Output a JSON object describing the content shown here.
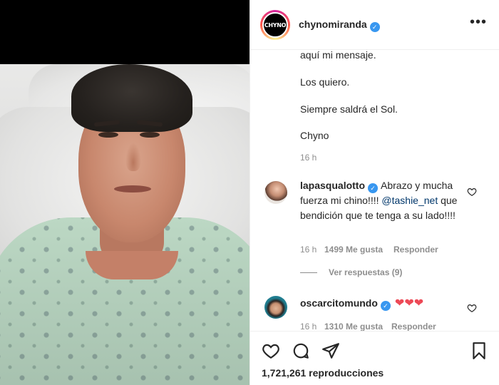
{
  "post": {
    "username": "chynomiranda",
    "avatar_text": "CHYNO",
    "more_icon": "more-horizontal-icon",
    "caption_lines": [
      "aquí mi mensaje.",
      "Los quiero.",
      "Siempre saldrá el Sol.",
      "Chyno"
    ],
    "caption_time": "16 h"
  },
  "comments": [
    {
      "user": "lapasqualotto",
      "text_before": "Abrazo y mucha fuerza mi chino!!!! ",
      "mention": "@tashie_net",
      "text_after": " que bendición que te tenga a su lado!!!!",
      "time": "16 h",
      "likes": "1499 Me gusta",
      "reply_label": "Responder",
      "view_replies": "Ver respuestas (9)"
    },
    {
      "user": "oscarcitomundo",
      "text": "❤❤❤",
      "time": "16 h",
      "likes": "1310 Me gusta",
      "reply_label": "Responder"
    }
  ],
  "actions": {
    "icons": [
      "heart-icon",
      "comment-icon",
      "share-icon",
      "bookmark-icon"
    ],
    "views": "1,721,261 reproducciones"
  },
  "colors": {
    "verified": "#3897f0",
    "heart": "#ed4956",
    "mention": "#00376b",
    "muted": "#8e8e8e"
  }
}
